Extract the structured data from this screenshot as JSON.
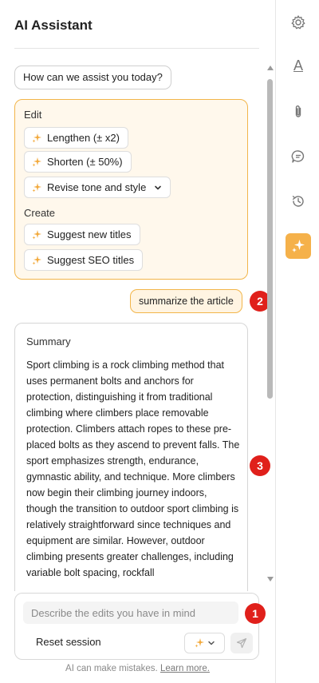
{
  "panel": {
    "title": "AI Assistant"
  },
  "chat": {
    "greeting": "How can we assist you today?",
    "actions": {
      "edit_label": "Edit",
      "create_label": "Create",
      "edit_items": [
        {
          "label": "Lengthen (± x2)",
          "icon": "sparkle-icon"
        },
        {
          "label": "Shorten (± 50%)",
          "icon": "sparkle-icon"
        },
        {
          "label": "Revise tone and style",
          "icon": "sparkle-icon",
          "has_dropdown": true
        }
      ],
      "create_items": [
        {
          "label": "Suggest new titles",
          "icon": "sparkle-icon"
        },
        {
          "label": "Suggest SEO titles",
          "icon": "sparkle-icon"
        }
      ]
    },
    "user_message": "summarize the article",
    "summary": {
      "title": "Summary",
      "body": "Sport climbing is a rock climbing method that uses permanent bolts and anchors for protection, distinguishing it from traditional climbing where climbers place removable protection. Climbers attach ropes to these pre-placed bolts as they ascend to prevent falls. The sport emphasizes strength, endurance, gymnastic ability, and technique. More climbers now begin their climbing journey indoors, though the transition to outdoor sport climbing is relatively straightforward since techniques and equipment are similar. However, outdoor climbing presents greater challenges, including variable bolt spacing, rockfall"
    }
  },
  "composer": {
    "placeholder": "Describe the edits you have in mind",
    "reset_label": "Reset session"
  },
  "footer": {
    "disclaimer": "AI can make mistakes.",
    "learn_more": "Learn more."
  },
  "badges": [
    "1",
    "2",
    "3"
  ],
  "rail": {
    "icons": [
      "gear-icon",
      "font-icon",
      "paperclip-icon",
      "comment-icon",
      "history-icon",
      "sparkle-icon"
    ],
    "font_glyph": "A"
  },
  "colors": {
    "accent": "#f5b14a",
    "accent_border": "#f2b54a",
    "accent_bg": "#fff8ec",
    "badge": "#e0201b"
  }
}
